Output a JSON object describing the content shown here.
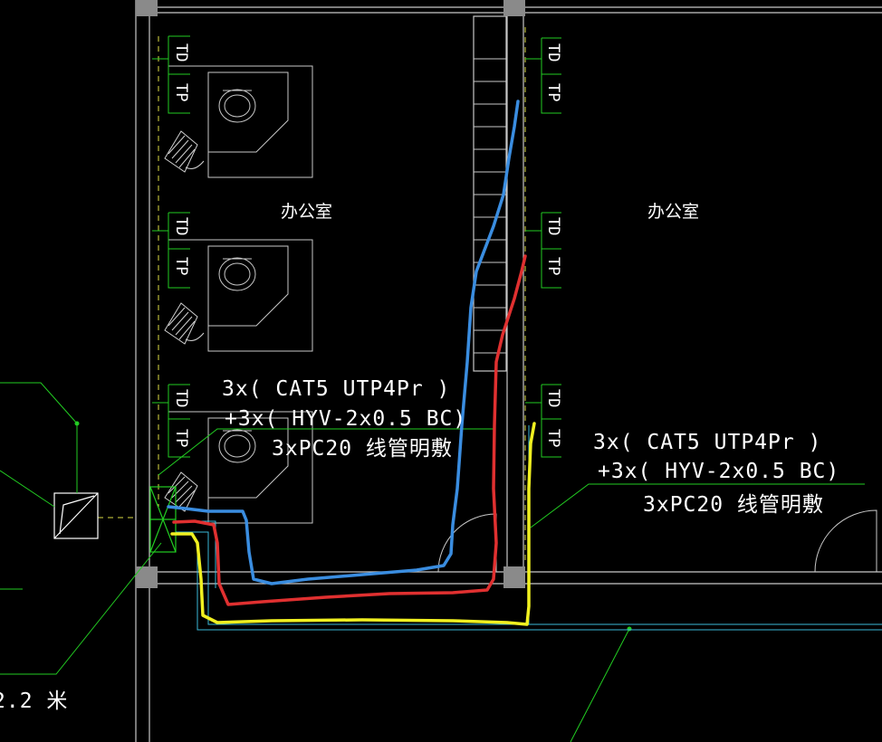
{
  "rooms": [
    {
      "label": "办公室"
    },
    {
      "label": "办公室"
    }
  ],
  "outlet_labels": {
    "data": "TD",
    "phone": "TP"
  },
  "notes": [
    {
      "line1": "3x( CAT5  UTP4Pr )",
      "line2": "+3x( HYV-2x0.5   BC)",
      "line3": "3xPC20 线管明敷"
    },
    {
      "line1": "3x( CAT5  UTP4Pr )",
      "line2": "+3x( HYV-2x0.5   BC)",
      "line3": "3xPC20 线管明敷"
    }
  ],
  "height_note": "2.2 米",
  "colors": {
    "background": "#000000",
    "wall": "#c8c8c8",
    "column": "#8a8a8a",
    "leader": "#22cc22",
    "centerline": "#dddd44",
    "conduit": "#3ab8d8",
    "cable_blue": "#3a8de0",
    "cable_red": "#e03030",
    "cable_yellow": "#f0f020"
  }
}
